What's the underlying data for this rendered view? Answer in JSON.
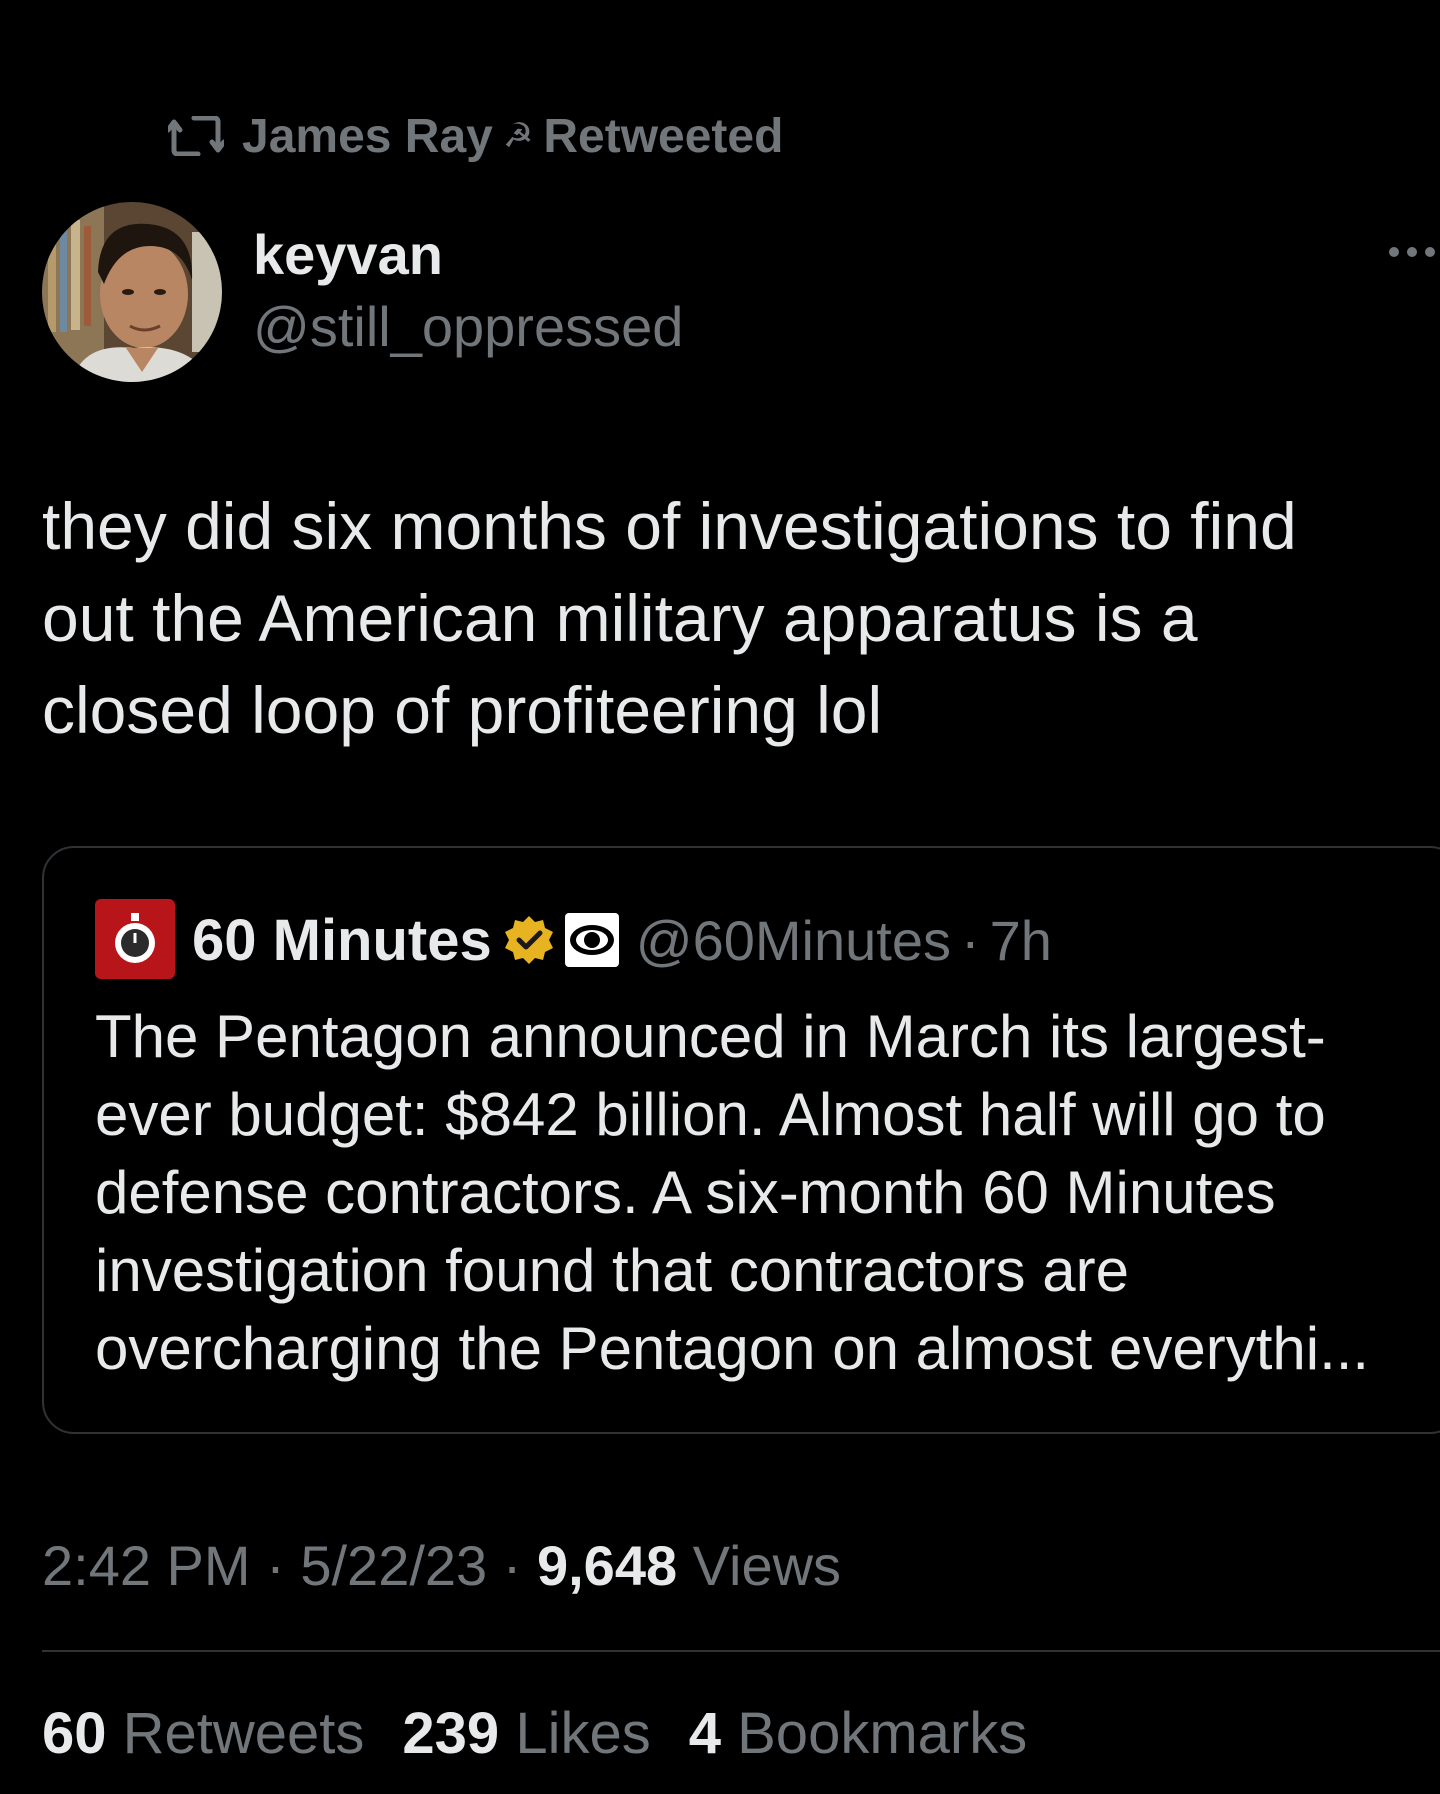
{
  "retweet_context": {
    "user": "James Ray",
    "badge_icon": "hammer-sickle-icon",
    "label": "Retweeted"
  },
  "author": {
    "name": "keyvan",
    "handle": "@still_oppressed"
  },
  "tweet": {
    "lines": [
      "they did six months of investigations to find",
      "out the American military apparatus is a",
      "closed loop of profiteering lol"
    ]
  },
  "quoted_tweet": {
    "name": "60 Minutes",
    "handle": "@60Minutes",
    "separator": "·",
    "time": "7h",
    "lines": [
      "The Pentagon announced in March its largest-",
      "ever budget: $842 billion. Almost half will go to",
      "defense contractors. A six-month 60 Minutes",
      "investigation found that contractors are",
      "overcharging the Pentagon on almost everythi..."
    ]
  },
  "meta": {
    "time": "2:42 PM",
    "separator": "·",
    "date": "5/22/23",
    "views_count": "9,648",
    "views_label": "Views"
  },
  "stats": {
    "retweets_count": "60",
    "retweets_label": "Retweets",
    "likes_count": "239",
    "likes_label": "Likes",
    "bookmarks_count": "4",
    "bookmarks_label": "Bookmarks"
  },
  "colors": {
    "background": "#000000",
    "text_primary": "#e7e9ea",
    "text_secondary": "#71767b",
    "border": "#2f3336",
    "verified_gold": "#e8b321",
    "cbs_red": "#b8151b"
  }
}
